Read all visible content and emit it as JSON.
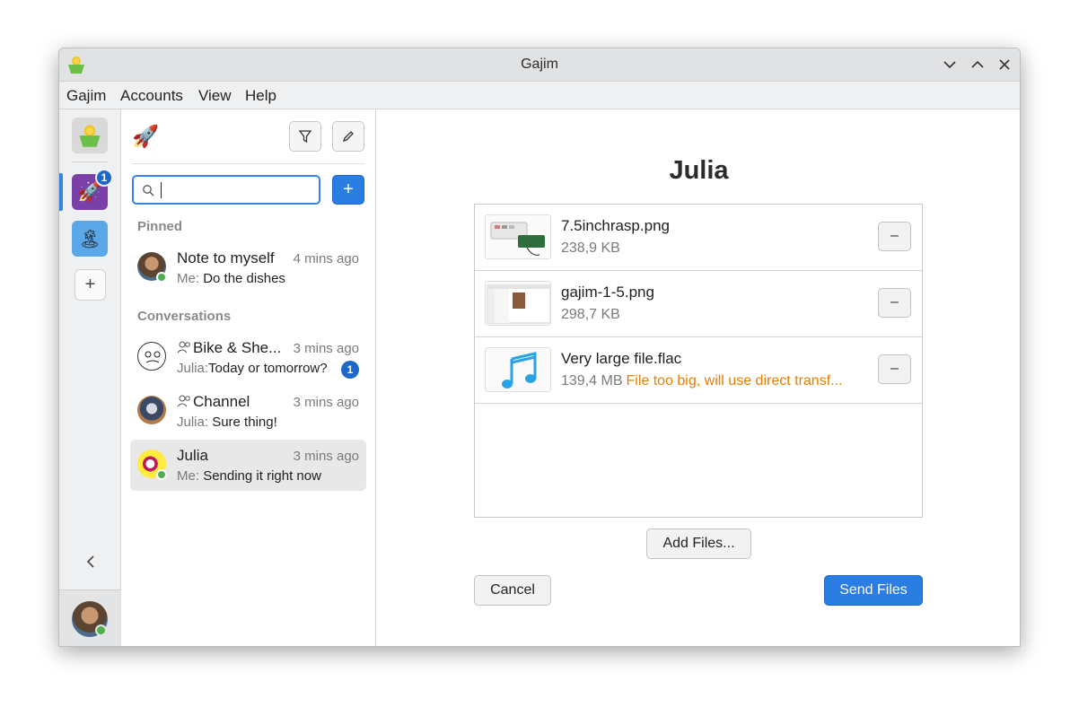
{
  "window": {
    "title": "Gajim"
  },
  "menu": [
    "Gajim",
    "Accounts",
    "View",
    "Help"
  ],
  "accounts": {
    "workspace_badge": "1"
  },
  "search": {
    "value": "",
    "placeholder": ""
  },
  "sections": {
    "pinned": "Pinned",
    "conversations": "Conversations"
  },
  "pinned": [
    {
      "name": "Note to myself",
      "time": "4 mins ago",
      "who": "Me:",
      "text": "Do the dishes"
    }
  ],
  "conversations": [
    {
      "name": "Bike & She...",
      "time": "3 mins ago",
      "who": "Julia:",
      "text": "Today or tomorrow?",
      "unread": "1",
      "group": true
    },
    {
      "name": "Channel",
      "time": "3 mins ago",
      "who": "Julia:",
      "text": "Sure thing!",
      "group": true
    },
    {
      "name": "Julia",
      "time": "3 mins ago",
      "who": "Me:",
      "text": "Sending it right now",
      "selected": true
    }
  ],
  "main": {
    "contact": "Julia",
    "files": [
      {
        "name": "7.5inchrasp.png",
        "size": "238,9 KB",
        "warning": ""
      },
      {
        "name": "gajim-1-5.png",
        "size": "298,7 KB",
        "warning": ""
      },
      {
        "name": "Very large file.flac",
        "size": "139,4 MB",
        "warning": "File too big, will use direct transf..."
      }
    ],
    "remove_label": "–",
    "add_files": "Add Files...",
    "cancel": "Cancel",
    "send": "Send Files"
  },
  "colors": {
    "accent": "#2a7de1",
    "warning": "#e67e00",
    "online": "#4caf50"
  }
}
